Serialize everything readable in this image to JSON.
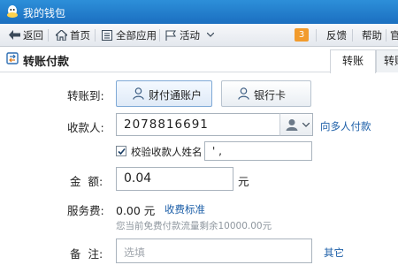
{
  "window": {
    "title": "我的钱包"
  },
  "toolbar": {
    "back_label": "返回",
    "home_label": "首页",
    "all_apps_label": "全部应用",
    "activity_label": "活动",
    "badge_count": "3",
    "feedback_label": "反馈",
    "help_label": "帮助",
    "more_label": "官"
  },
  "header": {
    "title": "转账付款",
    "tabs": [
      "转账",
      "转账"
    ]
  },
  "form": {
    "transfer_to_label": "转账到:",
    "option_account": "财付通账户",
    "option_bank_card": "银行卡",
    "payee_label": "收款人:",
    "payee_value": "2078816691",
    "multi_payee_link": "向多人付款",
    "verify_name_label": "校验收款人姓名",
    "verify_name_value": "' ,",
    "amount_label": "金  额:",
    "amount_value": "0.04",
    "amount_unit": "元",
    "fee_label": "服务费:",
    "fee_value": "0.00 元",
    "fee_link": "收费标准",
    "fee_hint": "您当前免费付款流量剩余10000.00元",
    "note_label": "备  注:",
    "note_placeholder": "选填",
    "other_link": "其它"
  }
}
